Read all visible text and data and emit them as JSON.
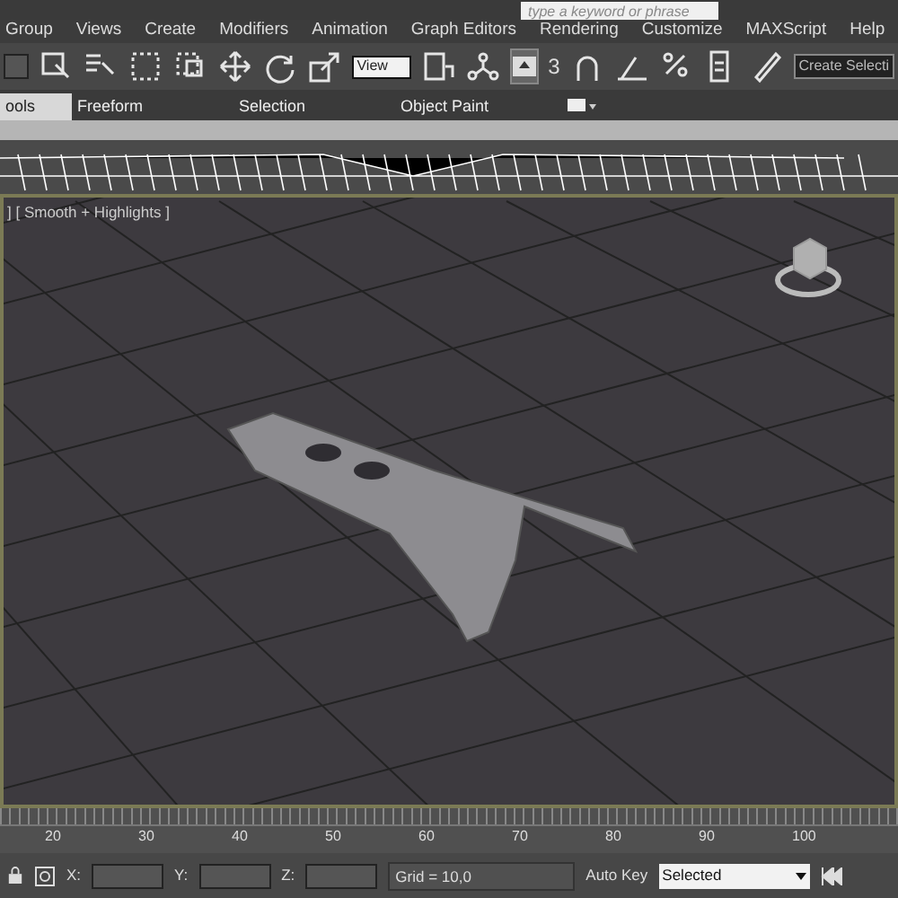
{
  "title_bar": {
    "search": {
      "placeholder": "type a keyword or phrase"
    }
  },
  "menu": [
    "Group",
    "Views",
    "Create",
    "Modifiers",
    "Animation",
    "Graph Editors",
    "Rendering",
    "Customize",
    "MAXScript",
    "Help"
  ],
  "toolbar": {
    "reference_coordinate": "View",
    "snap_label": "3",
    "named_selection": "Create Selecti"
  },
  "ribbon_tabs": [
    {
      "label": "ools",
      "selected": true
    },
    {
      "label": "Freeform",
      "selected": false
    },
    {
      "label": "Selection",
      "selected": false
    },
    {
      "label": "Object Paint",
      "selected": false
    }
  ],
  "viewport": {
    "label": "] [ Smooth + Highlights ]"
  },
  "timeline": {
    "ticks": [
      "20",
      "30",
      "40",
      "50",
      "60",
      "70",
      "80",
      "90",
      "100"
    ]
  },
  "status_bar": {
    "x_label": "X:",
    "y_label": "Y:",
    "z_label": "Z:",
    "grid": "Grid = 10,0",
    "auto_key": "Auto Key",
    "key_filter": "Selected"
  }
}
